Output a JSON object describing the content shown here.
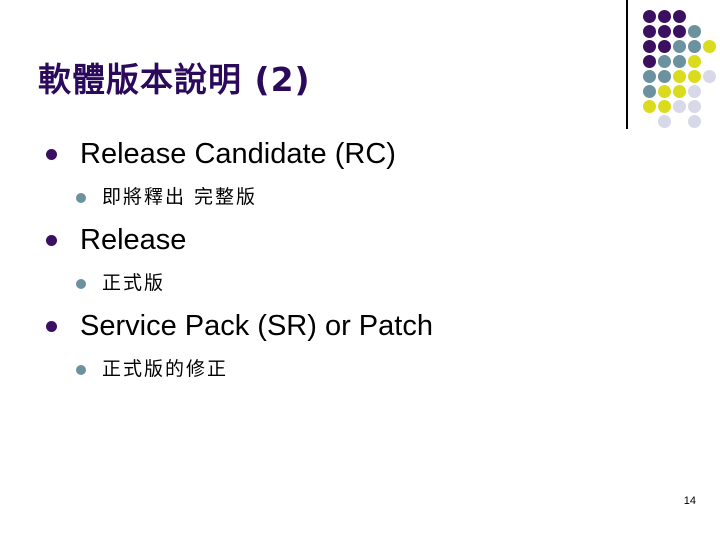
{
  "slide": {
    "title": "軟體版本說明 (2)",
    "page_number": "14",
    "background_color": "#FFFFFF",
    "title_color": "#2B0A5C",
    "divider_color": "#000000",
    "bullet_level1_color": "#3B1060",
    "bullet_level2_color": "#6B929E"
  },
  "content": {
    "items": [
      {
        "level1": "Release Candidate (RC)",
        "level2": "即將釋出 完整版"
      },
      {
        "level1": "Release",
        "level2": "正式版"
      },
      {
        "level1": "Service Pack (SR) or Patch",
        "level2": "正式版的修正"
      }
    ]
  },
  "decoration": {
    "name": "dot-grid",
    "columns": 5,
    "rows": 8,
    "cell_size": 15,
    "dot_size": 13,
    "palette": {
      "purple": "#3B1060",
      "teal": "#6B929E",
      "yellow": "#DBDB1E",
      "lightgray": "#D7D9E8"
    },
    "matrix": [
      [
        "purple",
        "purple",
        "purple",
        null,
        null
      ],
      [
        "purple",
        "purple",
        "purple",
        "teal",
        null
      ],
      [
        "purple",
        "purple",
        "teal",
        "teal",
        "yellow"
      ],
      [
        "purple",
        "teal",
        "teal",
        "yellow",
        null
      ],
      [
        "teal",
        "teal",
        "yellow",
        "yellow",
        "lightgray"
      ],
      [
        "teal",
        "yellow",
        "yellow",
        "lightgray",
        null
      ],
      [
        "yellow",
        "yellow",
        "lightgray",
        "lightgray",
        null
      ],
      [
        null,
        "lightgray",
        null,
        "lightgray",
        null
      ]
    ]
  }
}
